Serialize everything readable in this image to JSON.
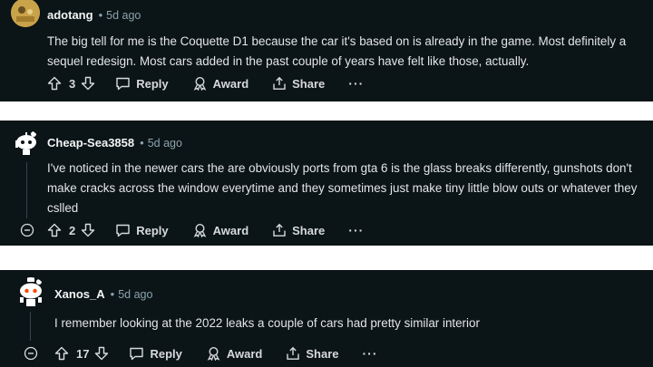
{
  "comments": [
    {
      "author": "adotang",
      "time": "5d ago",
      "body": "The big tell for me is the Coquette D1 because the car it's based on is already in the game. Most definitely a sequel redesign. Most cars added in the past couple of years have felt like those, actually.",
      "score": "3",
      "reply_label": "Reply",
      "award_label": "Award",
      "share_label": "Share",
      "more_label": "···",
      "avatar_color": "#c9a34a"
    },
    {
      "author": "Cheap-Sea3858",
      "time": "5d ago",
      "body": "I've noticed in the newer cars the are obviously ports from gta 6 is the glass breaks differently, gunshots don't make cracks across the window everytime and they sometimes just make tiny little blow outs or whatever they cslled",
      "score": "2",
      "reply_label": "Reply",
      "award_label": "Award",
      "share_label": "Share",
      "more_label": "···",
      "avatar_color": "#ffffff"
    },
    {
      "author": "Xanos_A",
      "time": "5d ago",
      "body": "I remember looking at the 2022 leaks a couple of cars had pretty similar interior",
      "score": "17",
      "reply_label": "Reply",
      "award_label": "Award",
      "share_label": "Share",
      "more_label": "···",
      "avatar_color": "#ffffff"
    }
  ],
  "colors": {
    "background": "#0b1416",
    "text": "#d7dadc",
    "muted": "#8ba2ad",
    "separator": "#ffffff"
  }
}
